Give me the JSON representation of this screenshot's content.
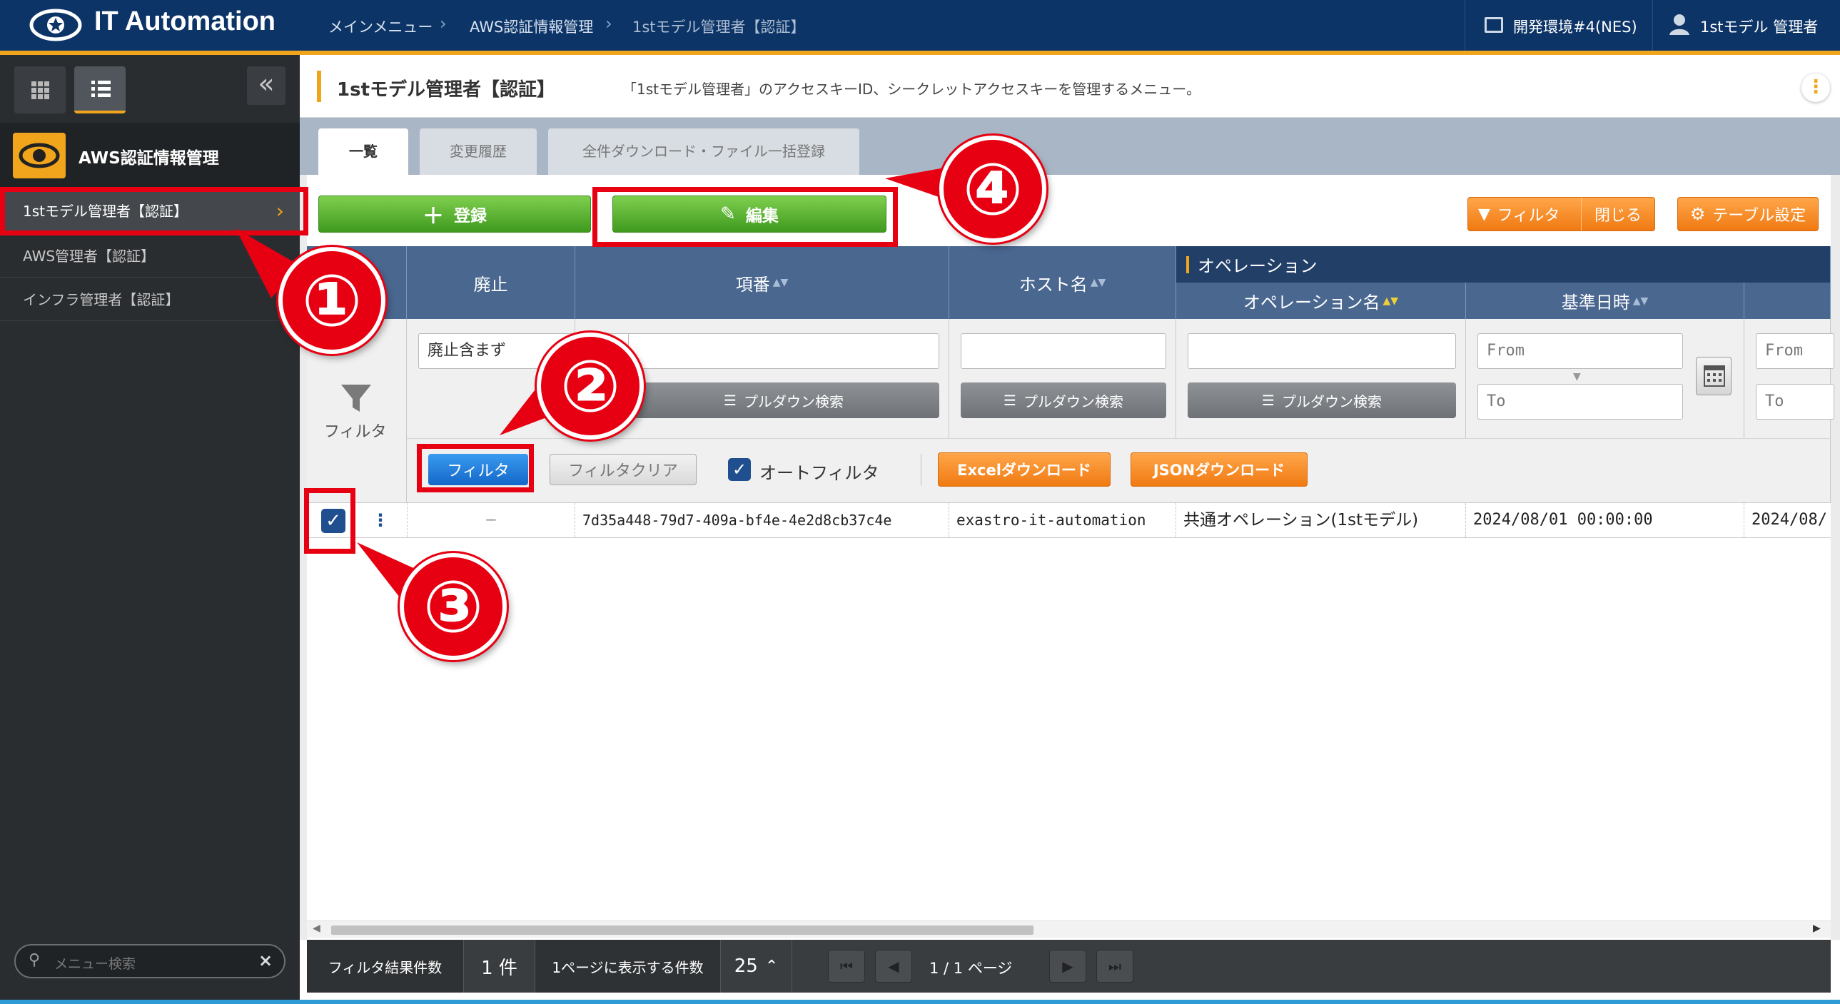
{
  "header": {
    "app_title": "IT Automation",
    "breadcrumbs": [
      "メインメニュー",
      "AWS認証情報管理",
      "1stモデル管理者【認証】"
    ],
    "environment": "開発環境#4(NES)",
    "user": "1stモデル 管理者"
  },
  "sidebar": {
    "group_title": "AWS認証情報管理",
    "items": [
      {
        "label": "1stモデル管理者【認証】",
        "active": true
      },
      {
        "label": "AWS管理者【認証】",
        "active": false
      },
      {
        "label": "インフラ管理者【認証】",
        "active": false
      }
    ],
    "search_placeholder": "メニュー検索"
  },
  "page": {
    "title": "1stモデル管理者【認証】",
    "description": "「1stモデル管理者」のアクセスキーID、シークレットアクセスキーを管理するメニュー。"
  },
  "tabs": [
    "一覧",
    "変更履歴",
    "全件ダウンロード・ファイル一括登録"
  ],
  "toolbar": {
    "register": "登録",
    "edit": "編集",
    "filter": "フィルタ",
    "close": "閉じる",
    "table_settings": "テーブル設定"
  },
  "table": {
    "headers": {
      "discard": "廃止",
      "item_no": "項番",
      "host": "ホスト名",
      "operation_group": "オペレーション",
      "operation_name": "オペレーション名",
      "base_datetime": "基準日時"
    },
    "filter": {
      "label": "フィルタ",
      "discard_value": "廃止含まず",
      "pulldown": "プルダウン検索",
      "from": "From",
      "to": "To",
      "filter_button": "フィルタ",
      "clear_button": "フィルタクリア",
      "auto_filter": "オートフィルタ",
      "excel": "Excelダウンロード",
      "json": "JSONダウンロード"
    },
    "rows": [
      {
        "discard": "—",
        "item_no": "7d35a448-79d7-409a-bf4e-4e2d8cb37c4e",
        "host": "exastro-it-automation",
        "operation": "共通オペレーション(1stモデル)",
        "base_datetime": "2024/08/01 00:00:00",
        "extra": "2024/08/"
      }
    ]
  },
  "footer": {
    "filter_count_label": "フィルタ結果件数",
    "filter_count": "1 件",
    "per_page_label": "1ページに表示する件数",
    "per_page": "25",
    "page_info": "1 / 1 ページ"
  },
  "callouts": [
    "①",
    "②",
    "③",
    "④"
  ],
  "colors": {
    "header": "#0c3467",
    "accent": "#f0a51c",
    "green": "#4aa624",
    "orange": "#f58a1f",
    "blue": "#1f7fe0",
    "red": "#e60012"
  }
}
